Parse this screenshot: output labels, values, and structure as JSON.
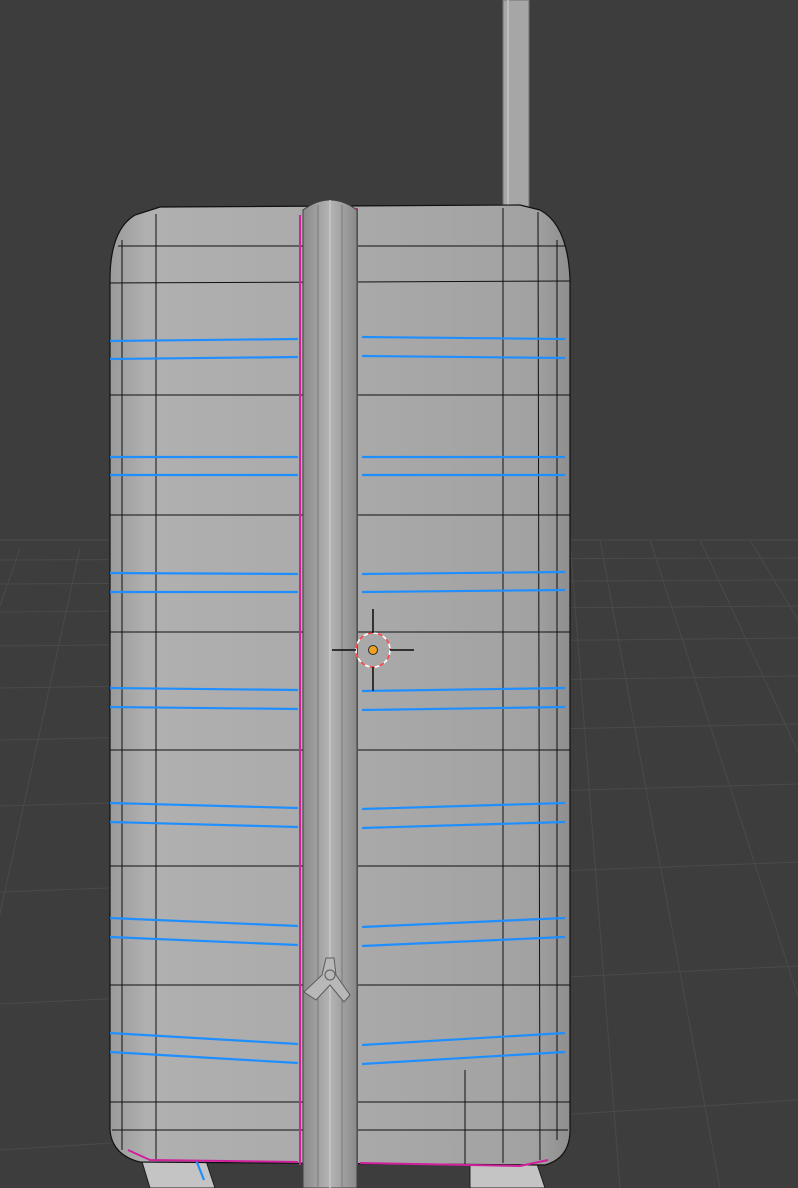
{
  "viewport": {
    "background": "#3d3d3d",
    "floor_grid_color": "#4a4a4a",
    "view_mode": "edit-mode-wireframe-overlay"
  },
  "object": {
    "name_icon": "suitcase-mesh",
    "surface_color": "#a9a9a9",
    "wire_color": "#101010",
    "selected_edge_color": "#1f8fff",
    "seam_edge_color": "#d0209c",
    "parts": [
      "shell",
      "zipper-strip",
      "zipper-pull",
      "telescoping-handle",
      "wheels"
    ]
  },
  "cursor_3d": {
    "icon": "3d-cursor-icon",
    "ring_colors": [
      "#ff4a4a",
      "#ffffff"
    ],
    "center_color": "#f0a020"
  },
  "origin_point": {
    "icon": "object-origin-icon",
    "color": "#f0a020"
  }
}
